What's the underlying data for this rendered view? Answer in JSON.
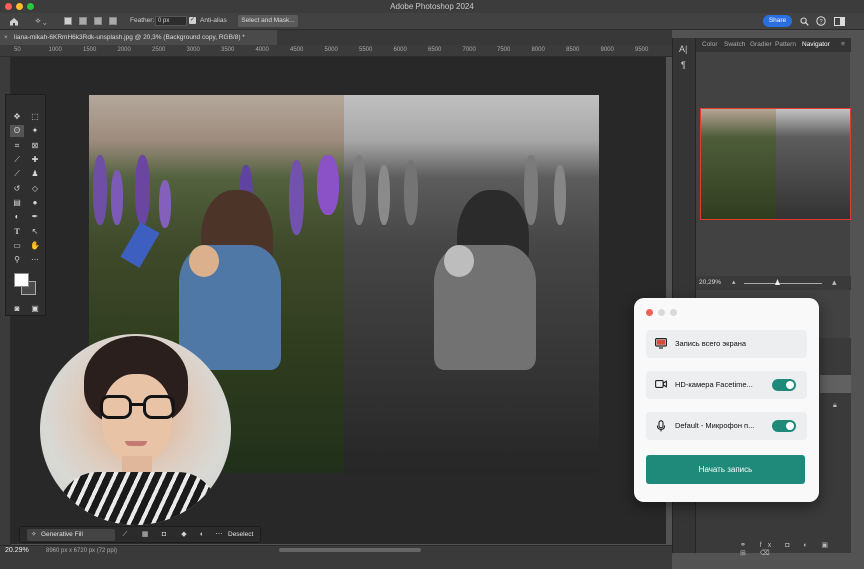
{
  "app": {
    "window_title": "Adobe Photoshop 2024",
    "traffic_lights": [
      "#fe5f57",
      "#febc2e",
      "#28c840"
    ]
  },
  "options_bar": {
    "feather_label": "Feather:",
    "feather_value": "0 px",
    "antialias_label": "Anti-alias",
    "select_mask_label": "Select and Mask...",
    "share_label": "Share"
  },
  "document": {
    "tab_label": "liana-mikah-6KRmH6k3Rdk-unsplash.jpg @ 20,3% (Background copy, RGB/8) *",
    "zoom": "20.29%",
    "dimensions": "8960 px x 6720 px (72 ppi)"
  },
  "rulers": {
    "horizontal": [
      "50",
      "1000",
      "1500",
      "2000",
      "2500",
      "3000",
      "3500",
      "4000",
      "4500",
      "5000",
      "5500",
      "6000",
      "6500",
      "7000",
      "7500",
      "8000",
      "8500",
      "9000",
      "9500"
    ]
  },
  "contextual_taskbar": {
    "generative_fill_label": "Generative Fill",
    "deselect_label": "Deselect"
  },
  "right_panel": {
    "tabs": [
      "Color",
      "Swatch",
      "Gradier",
      "Pattern",
      "Navigator"
    ],
    "active_tab": "Navigator",
    "navigator_zoom": "20,29%"
  },
  "recorder": {
    "full_screen_label": "Запись всего экрана",
    "camera_label": "HD-камера Facetime...",
    "mic_label": "Default - Микрофон п...",
    "camera_on": true,
    "mic_on": true,
    "start_label": "Начать запись",
    "accent_color": "#1f8a7a"
  }
}
